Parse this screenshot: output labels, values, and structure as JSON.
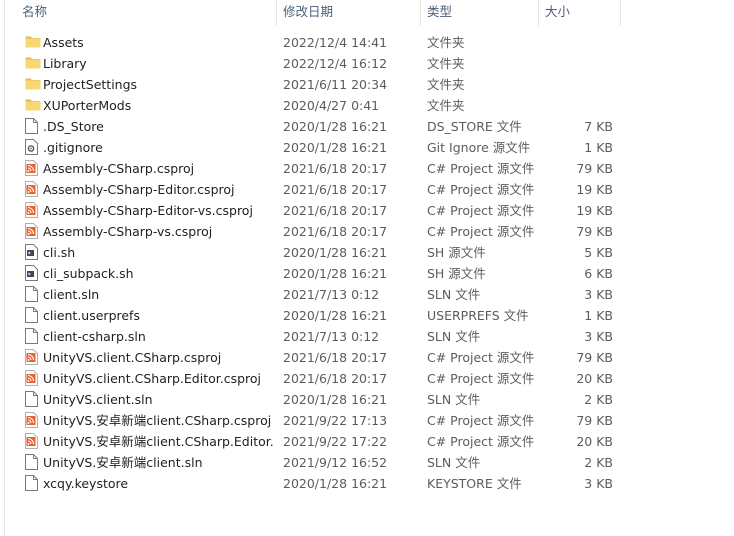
{
  "columns": {
    "name": "名称",
    "modified": "修改日期",
    "type": "类型",
    "size": "大小"
  },
  "files": [
    {
      "name": "Assets",
      "modified": "2022/12/4 14:41",
      "type": "文件夹",
      "size": "",
      "icon": "folder-icon"
    },
    {
      "name": "Library",
      "modified": "2022/12/4 16:12",
      "type": "文件夹",
      "size": "",
      "icon": "folder-icon"
    },
    {
      "name": "ProjectSettings",
      "modified": "2021/6/11 20:34",
      "type": "文件夹",
      "size": "",
      "icon": "folder-icon"
    },
    {
      "name": "XUPorterMods",
      "modified": "2020/4/27 0:41",
      "type": "文件夹",
      "size": "",
      "icon": "folder-icon"
    },
    {
      "name": ".DS_Store",
      "modified": "2020/1/28 16:21",
      "type": "DS_STORE 文件",
      "size": "7 KB",
      "icon": "file-icon"
    },
    {
      "name": ".gitignore",
      "modified": "2020/1/28 16:21",
      "type": "Git Ignore 源文件",
      "size": "1 KB",
      "icon": "gear-file-icon"
    },
    {
      "name": "Assembly-CSharp.csproj",
      "modified": "2021/6/18 20:17",
      "type": "C# Project 源文件",
      "size": "79 KB",
      "icon": "rss-file-icon"
    },
    {
      "name": "Assembly-CSharp-Editor.csproj",
      "modified": "2021/6/18 20:17",
      "type": "C# Project 源文件",
      "size": "19 KB",
      "icon": "rss-file-icon"
    },
    {
      "name": "Assembly-CSharp-Editor-vs.csproj",
      "modified": "2021/6/18 20:17",
      "type": "C# Project 源文件",
      "size": "19 KB",
      "icon": "rss-file-icon"
    },
    {
      "name": "Assembly-CSharp-vs.csproj",
      "modified": "2021/6/18 20:17",
      "type": "C# Project 源文件",
      "size": "79 KB",
      "icon": "rss-file-icon"
    },
    {
      "name": "cli.sh",
      "modified": "2020/1/28 16:21",
      "type": "SH 源文件",
      "size": "5 KB",
      "icon": "script-file-icon"
    },
    {
      "name": "cli_subpack.sh",
      "modified": "2020/1/28 16:21",
      "type": "SH 源文件",
      "size": "6 KB",
      "icon": "script-file-icon"
    },
    {
      "name": "client.sln",
      "modified": "2021/7/13 0:12",
      "type": "SLN 文件",
      "size": "3 KB",
      "icon": "file-icon"
    },
    {
      "name": "client.userprefs",
      "modified": "2020/1/28 16:21",
      "type": "USERPREFS 文件",
      "size": "1 KB",
      "icon": "file-icon"
    },
    {
      "name": "client-csharp.sln",
      "modified": "2021/7/13 0:12",
      "type": "SLN 文件",
      "size": "3 KB",
      "icon": "file-icon"
    },
    {
      "name": "UnityVS.client.CSharp.csproj",
      "modified": "2021/6/18 20:17",
      "type": "C# Project 源文件",
      "size": "79 KB",
      "icon": "rss-file-icon"
    },
    {
      "name": "UnityVS.client.CSharp.Editor.csproj",
      "modified": "2021/6/18 20:17",
      "type": "C# Project 源文件",
      "size": "20 KB",
      "icon": "rss-file-icon"
    },
    {
      "name": "UnityVS.client.sln",
      "modified": "2020/1/28 16:21",
      "type": "SLN 文件",
      "size": "2 KB",
      "icon": "file-icon"
    },
    {
      "name": "UnityVS.安卓新端client.CSharp.csproj",
      "modified": "2021/9/22 17:13",
      "type": "C# Project 源文件",
      "size": "79 KB",
      "icon": "rss-file-icon"
    },
    {
      "name": "UnityVS.安卓新端client.CSharp.Editor.c...",
      "modified": "2021/9/22 17:22",
      "type": "C# Project 源文件",
      "size": "20 KB",
      "icon": "rss-file-icon"
    },
    {
      "name": "UnityVS.安卓新端client.sln",
      "modified": "2021/9/12 16:52",
      "type": "SLN 文件",
      "size": "2 KB",
      "icon": "file-icon"
    },
    {
      "name": "xcqy.keystore",
      "modified": "2020/1/28 16:21",
      "type": "KEYSTORE 文件",
      "size": "3 KB",
      "icon": "file-icon"
    }
  ],
  "colors": {
    "folder": "#f8d775",
    "folder_dark": "#e5b84a",
    "rss": "#e8622c",
    "header_text": "#4c607a"
  }
}
